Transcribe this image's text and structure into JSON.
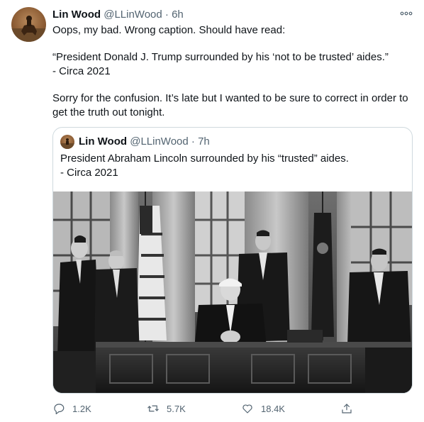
{
  "tweet": {
    "author_name": "Lin Wood",
    "author_handle": "@LLinWood",
    "separator": "·",
    "time": "6h",
    "lines": [
      "Oops, my bad. Wrong caption. Should have read:",
      "“President Donald J. Trump surrounded by his ‘not to be trusted’ aides.”",
      "- Circa 2021",
      "Sorry for the confusion. It’s late but I wanted to be sure to correct in order to get the truth out tonight."
    ]
  },
  "quoted_tweet": {
    "author_name": "Lin Wood",
    "author_handle": "@LLinWood",
    "separator": "·",
    "time": "7h",
    "lines": [
      "President Abraham Lincoln surrounded by his “trusted” aides.",
      "- Circa 2021"
    ]
  },
  "actions": {
    "reply_count": "1.2K",
    "retweet_count": "5.7K",
    "like_count": "18.4K"
  },
  "icons": [
    "more-icon",
    "reply-icon",
    "retweet-icon",
    "like-icon",
    "share-icon"
  ],
  "colors": {
    "text": "#0f1419",
    "secondary": "#536471",
    "border": "#cfd9de"
  }
}
